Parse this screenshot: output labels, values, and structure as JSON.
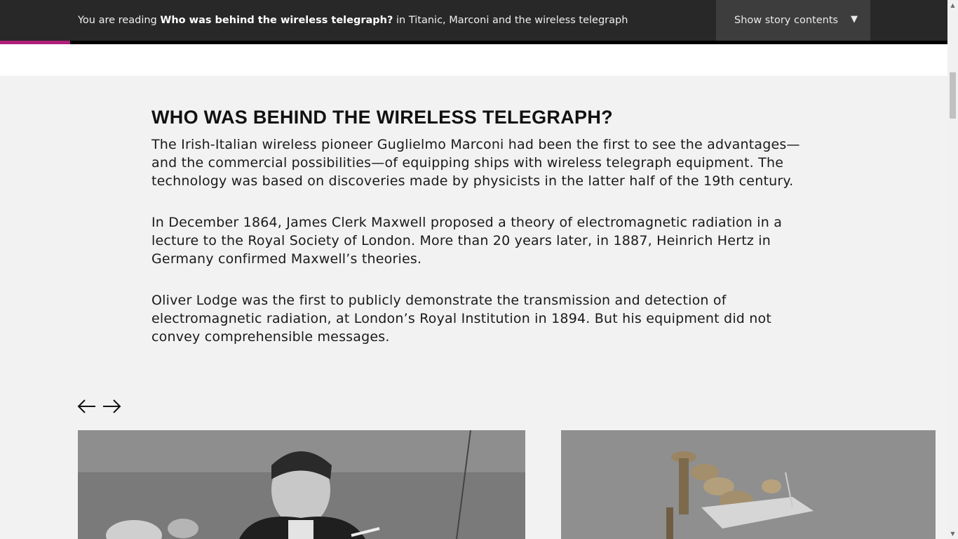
{
  "header": {
    "reading_prefix": "You are reading ",
    "reading_title": "Who was behind the wireless telegraph?",
    "reading_in": " in Titanic, Marconi and the wireless telegraph",
    "story_button_label": "Show story contents",
    "story_button_icon": "triangle-down-icon",
    "progress_fraction": 0.074,
    "progress_color": "#b01e7c"
  },
  "article": {
    "heading": "Who was behind the wireless telegraph?",
    "paragraphs": [
      "The Irish-Italian wireless pioneer Guglielmo Marconi had been the first to see the advantages—and the commercial possibilities—of equipping ships with wireless telegraph equipment. The technology was based on discoveries made by physicists in the latter half of the 19th century.",
      "In December 1864, James Clerk Maxwell proposed a theory of electromagnetic radiation in a lecture to the Royal Society of London. More than 20 years later, in 1887, Heinrich Hertz in Germany confirmed Maxwell’s theories.",
      "Oliver Lodge was the first to publicly demonstrate the transmission and detection of electromagnetic radiation, at London’s Royal Institution in 1894. But his equipment did not convey comprehensible messages."
    ]
  },
  "carousel": {
    "prev_icon": "arrow-left-icon",
    "next_icon": "arrow-right-icon"
  }
}
